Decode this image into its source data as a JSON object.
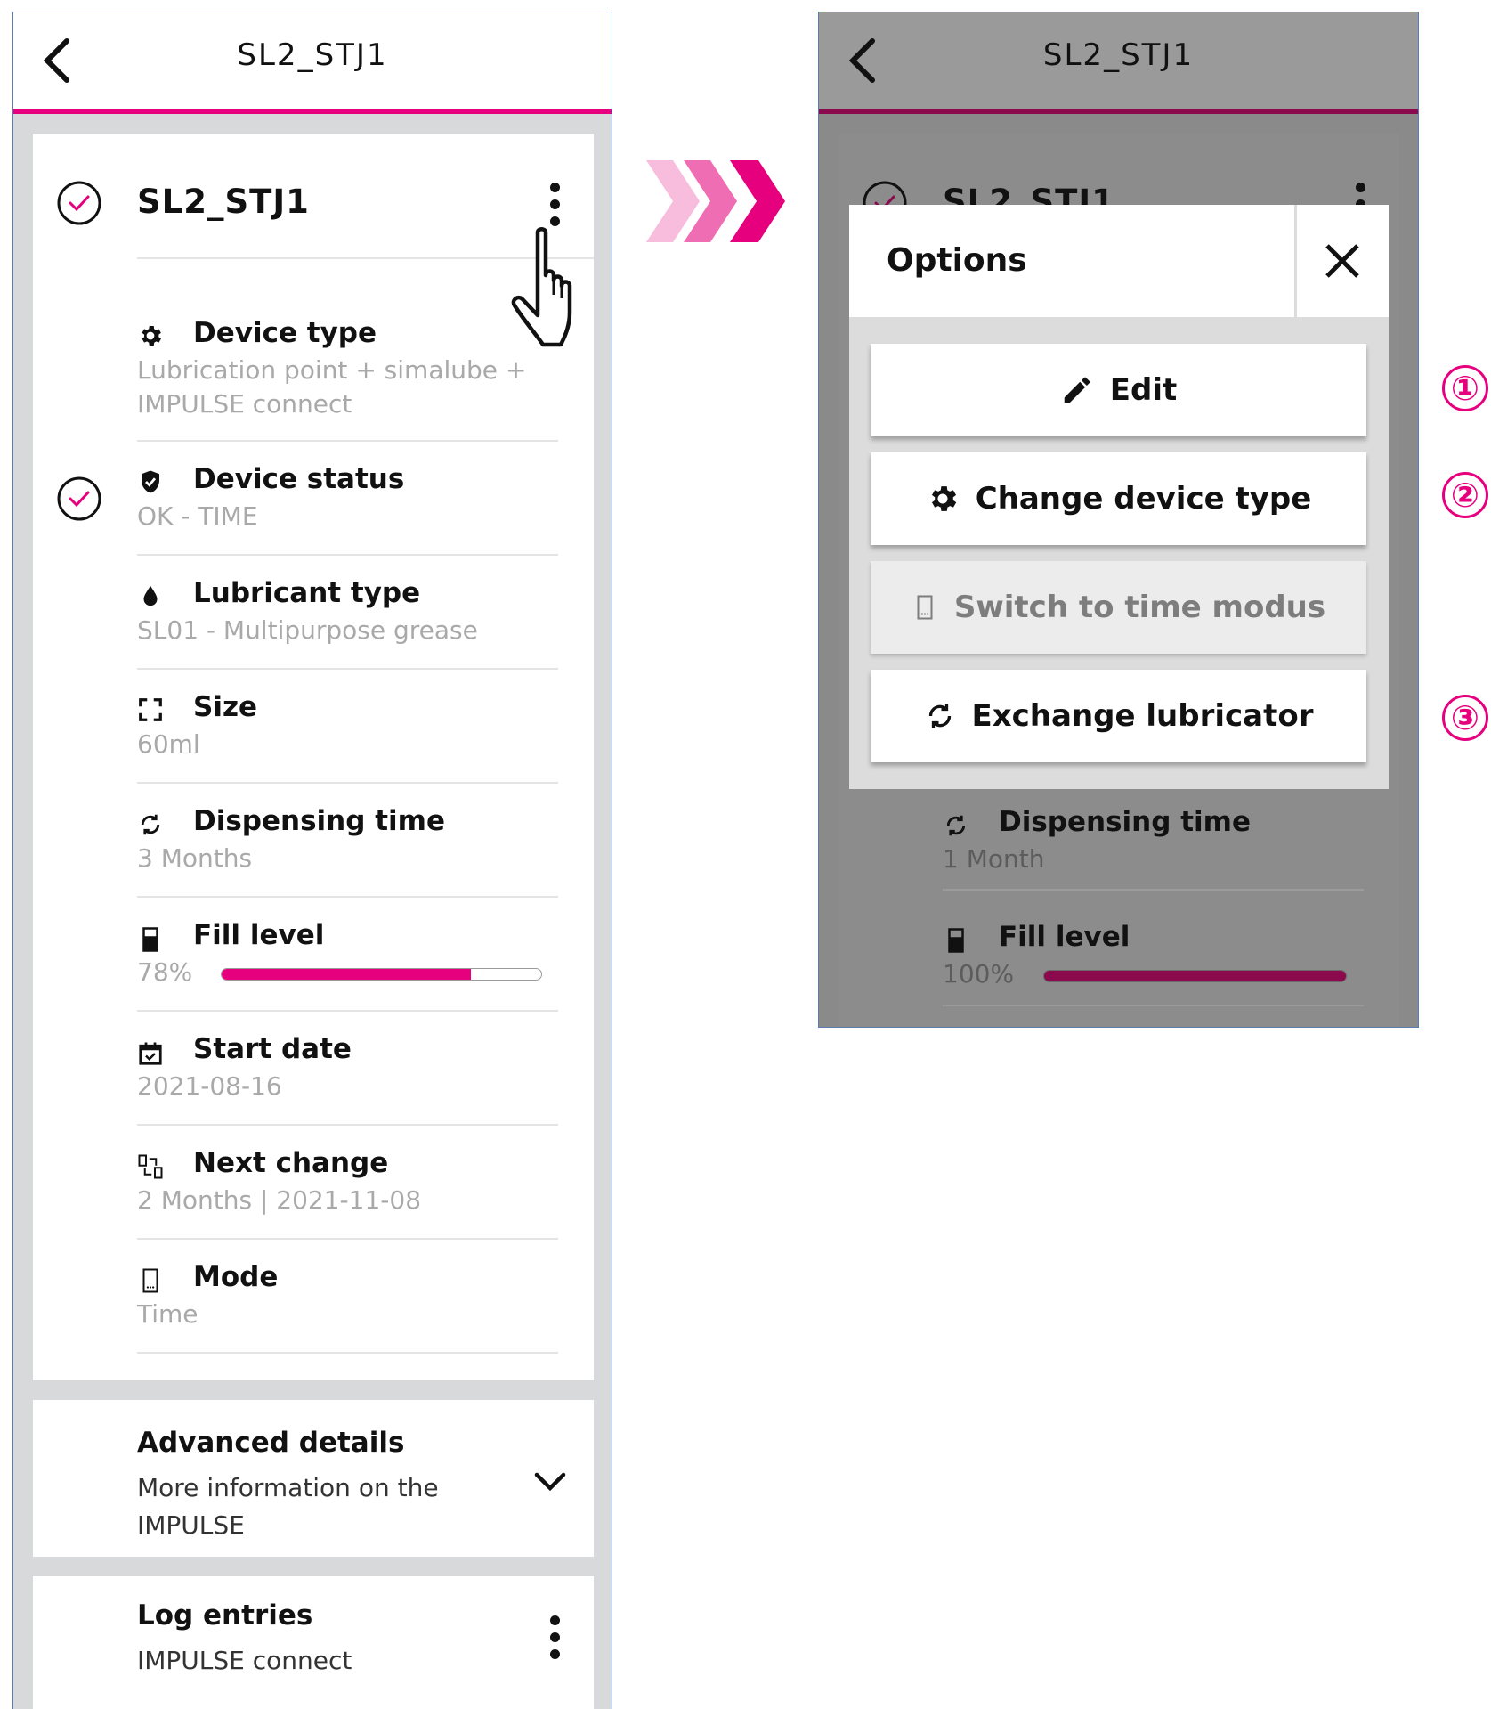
{
  "left": {
    "header": {
      "title": "SL2_STJ1"
    },
    "card": {
      "title": "SL2_STJ1",
      "rows": [
        {
          "label": "Device type",
          "value": "Lubrication point + simalube +",
          "value2": "IMPULSE connect",
          "icon": "gear-icon"
        },
        {
          "label": "Device status",
          "value": "OK - TIME",
          "icon": "shield-check-icon"
        },
        {
          "label": "Lubricant type",
          "value": "SL01 - Multipurpose grease",
          "icon": "drop-icon"
        },
        {
          "label": "Size",
          "value": "60ml",
          "icon": "size-frame-icon"
        },
        {
          "label": "Dispensing time",
          "value": "3 Months",
          "icon": "cycle-icon"
        },
        {
          "label": "Fill level",
          "value": "78%",
          "fill_level": 0.78,
          "icon": "fill-level-icon"
        },
        {
          "label": "Start date",
          "value": "2021-08-16",
          "icon": "calendar-check-icon"
        },
        {
          "label": "Next change",
          "value": "2 Months | 2021-11-08",
          "icon": "exchange-icon"
        },
        {
          "label": "Mode",
          "value": "Time",
          "icon": "device-mode-icon"
        }
      ]
    },
    "advanced": {
      "title": "Advanced details",
      "subtitle_line1": "More information on the",
      "subtitle_line2": "IMPULSE"
    },
    "log": {
      "title": "Log entries",
      "subtitle": "IMPULSE connect"
    }
  },
  "right": {
    "header": {
      "title": "SL2_STJ1"
    },
    "card": {
      "title": "SL2_STJ1"
    },
    "options": {
      "title": "Options",
      "buttons": [
        {
          "label": "Edit",
          "icon": "pencil-icon",
          "enabled": true
        },
        {
          "label": "Change device type",
          "icon": "gear-icon",
          "enabled": true
        },
        {
          "label": "Switch to time modus",
          "icon": "device-mode-icon",
          "enabled": false
        },
        {
          "label": "Exchange lubricator",
          "icon": "cycle-icon",
          "enabled": true
        }
      ]
    },
    "rows": [
      {
        "label": "Dispensing time",
        "value": "1 Month"
      },
      {
        "label": "Fill level",
        "value": "100%",
        "fill_level": 1.0
      }
    ]
  },
  "badges": [
    "①",
    "②",
    "③"
  ],
  "colors": {
    "accent": "#e6007e",
    "accent_dim": "#8a0a4d",
    "divider": "#e4e4e4",
    "muted_text": "#a9a9a9"
  }
}
